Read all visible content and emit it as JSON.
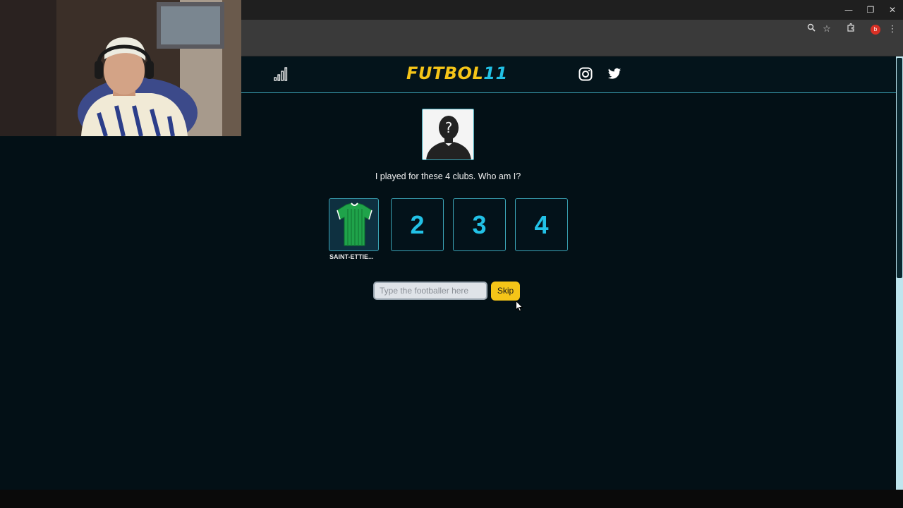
{
  "window": {
    "controls": [
      "—",
      "❐",
      "✕"
    ]
  },
  "header": {
    "logo_part1": "FUTBOL",
    "logo_part2": "11"
  },
  "game": {
    "prompt": "I played for these 4 clubs. Who am I?",
    "clubs": [
      {
        "label": "SAINT-ETTIE...",
        "revealed": true,
        "jersey_color": "#1fa34a"
      },
      {
        "number": "2",
        "revealed": false
      },
      {
        "number": "3",
        "revealed": false
      },
      {
        "number": "4",
        "revealed": false
      }
    ],
    "avatar_symbol": "?",
    "input_placeholder": "Type the footballer here",
    "skip_label": "Skip"
  },
  "colors": {
    "accent_yellow": "#f5c518",
    "accent_cyan": "#22c1e6",
    "background": "#031016"
  },
  "icons": [
    "stats-icon",
    "instagram-icon",
    "twitter-icon",
    "zoom-icon",
    "star-icon",
    "extensions-icon",
    "menu-icon"
  ],
  "browser": {
    "profile_initial": "b"
  }
}
